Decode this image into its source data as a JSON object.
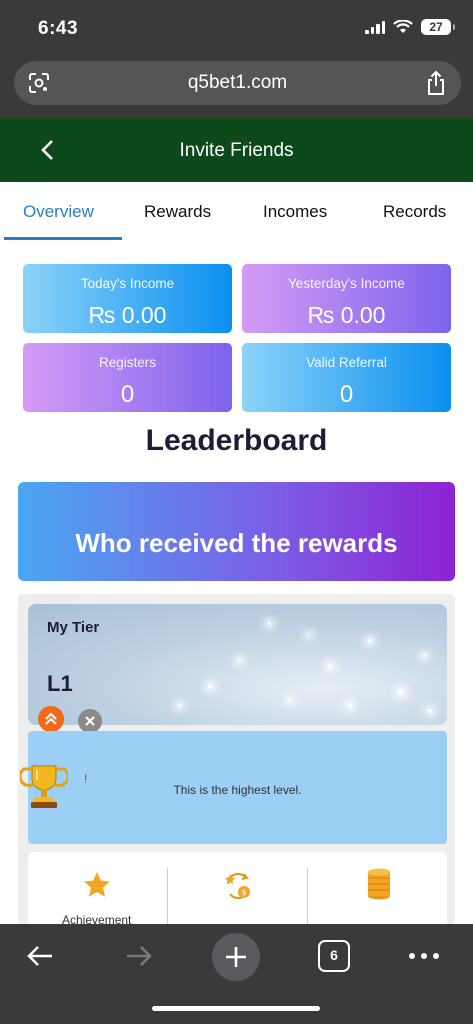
{
  "status_bar": {
    "time": "6:43",
    "battery": "27"
  },
  "browser": {
    "url": "q5bet1.com",
    "tab_count": "6"
  },
  "header": {
    "title": "Invite Friends"
  },
  "tabs": [
    {
      "label": "Overview",
      "active": true
    },
    {
      "label": "Rewards",
      "active": false
    },
    {
      "label": "Incomes",
      "active": false
    },
    {
      "label": "Records",
      "active": false
    }
  ],
  "stats": {
    "today_income": {
      "label": "Today's Income",
      "value": "₨ 0.00"
    },
    "yesterday_income": {
      "label": "Yesterday's Income",
      "value": "₨ 0.00"
    },
    "registers": {
      "label": "Registers",
      "value": "0"
    },
    "valid_referral": {
      "label": "Valid Referral",
      "value": "0"
    }
  },
  "leaderboard": {
    "heading": "Leaderboard",
    "banner": "Who received the rewards"
  },
  "tier": {
    "title": "My Tier",
    "level": "L1",
    "message": "This is the highest level."
  },
  "actions": [
    {
      "icon": "star-icon",
      "label": "Achievement"
    },
    {
      "icon": "exchange-coin-icon",
      "label": ""
    },
    {
      "icon": "coin-stack-icon",
      "label": ""
    }
  ],
  "colors": {
    "header_bg": "#0d4a1b",
    "tab_active": "#2a7dc6",
    "card_blue": "#0a8ff0",
    "card_purple": "#7d63ec"
  }
}
